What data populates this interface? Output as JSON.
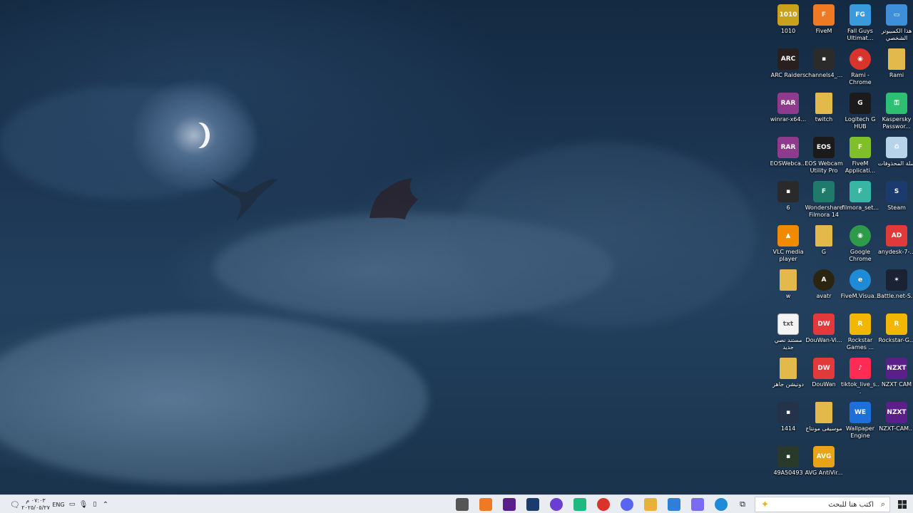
{
  "desktop_icons": [
    {
      "label": "1010",
      "icon": "game-box-icon",
      "color": "#c8a21a"
    },
    {
      "label": "FiveM",
      "icon": "fivem-icon",
      "color": "#f07a24"
    },
    {
      "label": "Fall Guys Ultimat...",
      "icon": "fall-guys-icon",
      "color": "#3a9bdc"
    },
    {
      "label": "هذا الكمبيوتر الشخصي",
      "icon": "computer-icon",
      "color": "#3c8fd8"
    },
    {
      "label": "ARC Raiders",
      "icon": "arc-raiders-icon",
      "color": "#2a1f1f"
    },
    {
      "label": "channels4_...",
      "icon": "image-file-icon",
      "color": "#2b2b2b"
    },
    {
      "label": "Rami - Chrome",
      "icon": "chrome-icon",
      "color": "#d9342b"
    },
    {
      "label": "Rami",
      "icon": "folder-icon",
      "color": "#e2b94a"
    },
    {
      "label": "winrar-x64...",
      "icon": "winrar-icon",
      "color": "#8e3b8e"
    },
    {
      "label": "twitch",
      "icon": "folder-icon",
      "color": "#e2b94a"
    },
    {
      "label": "Logitech G HUB",
      "icon": "logitech-g-icon",
      "color": "#1b1b1b"
    },
    {
      "label": "Kaspersky Passwor...",
      "icon": "kaspersky-key-icon",
      "color": "#2fbf71"
    },
    {
      "label": "EOSWebca...",
      "icon": "winrar-icon",
      "color": "#8e3b8e"
    },
    {
      "label": "EOS Webcam Utility Pro",
      "icon": "eos-webcam-icon",
      "color": "#1a1a1a"
    },
    {
      "label": "FiveM Applicati...",
      "icon": "fivem-app-icon",
      "color": "#7fbf2a"
    },
    {
      "label": "سلة المحذوفات",
      "icon": "recycle-bin-icon",
      "color": "#b8d4ea"
    },
    {
      "label": "6",
      "icon": "image-file-icon",
      "color": "#2a2a2a"
    },
    {
      "label": "Wondershare Filmora 14",
      "icon": "filmora-icon",
      "color": "#1f7a6b"
    },
    {
      "label": "filmora_set...",
      "icon": "filmora-setup-icon",
      "color": "#39b5a3"
    },
    {
      "label": "Steam",
      "icon": "steam-icon",
      "color": "#1b3b6f"
    },
    {
      "label": "VLC media player",
      "icon": "vlc-icon",
      "color": "#f08a00"
    },
    {
      "label": "G",
      "icon": "folder-icon",
      "color": "#e2b94a"
    },
    {
      "label": "Google Chrome",
      "icon": "chrome-icon",
      "color": "#2d9b4a"
    },
    {
      "label": "anydesk-7-...",
      "icon": "anydesk-icon",
      "color": "#e23a3a"
    },
    {
      "label": "w",
      "icon": "folder-icon",
      "color": "#e2b94a"
    },
    {
      "label": "avatr",
      "icon": "avatr-icon",
      "color": "#2a2410"
    },
    {
      "label": "FiveM.Visua...",
      "icon": "edge-icon",
      "color": "#1f8ad6"
    },
    {
      "label": "Battle.net-S...",
      "icon": "battlenet-icon",
      "color": "#1a2233"
    },
    {
      "label": "مستند نصي جديد",
      "icon": "text-document-icon",
      "color": "#f4f4f4"
    },
    {
      "label": "DouWan-Vi...",
      "icon": "douwan-icon",
      "color": "#e2393b"
    },
    {
      "label": "Rockstar Games ...",
      "icon": "rockstar-icon",
      "color": "#f2b705"
    },
    {
      "label": "Rockstar-G...",
      "icon": "rockstar-icon",
      "color": "#f2b705"
    },
    {
      "label": "دونيشن جاهز",
      "icon": "folder-icon",
      "color": "#e2b94a"
    },
    {
      "label": "DouWan",
      "icon": "douwan-icon",
      "color": "#e2393b"
    },
    {
      "label": "tiktok_live_s...",
      "icon": "tiktok-icon",
      "color": "#fe2c55"
    },
    {
      "label": "NZXT CAM",
      "icon": "nzxt-icon",
      "color": "#5b1f8a"
    },
    {
      "label": "1414",
      "icon": "image-file-icon",
      "color": "#24324a"
    },
    {
      "label": "موسيقى مونتاج",
      "icon": "folder-icon",
      "color": "#e2b94a"
    },
    {
      "label": "Wallpaper Engine",
      "icon": "wallpaper-engine-icon",
      "color": "#1e6fd9"
    },
    {
      "label": "NZXT-CAM...",
      "icon": "nzxt-icon",
      "color": "#5b1f8a"
    },
    {
      "label": "49A50493",
      "icon": "image-file-icon",
      "color": "#2a3a2a"
    },
    {
      "label": "AVG AntiVir...",
      "icon": "avg-icon",
      "color": "#e8a317"
    }
  ],
  "icon_texts": {
    "fall_guys": "FG",
    "arc": "ARC",
    "eos": "EOS",
    "nzxt": "NZXT",
    "avatr": "A",
    "g": "G",
    "r": "R",
    "steam": "S",
    "filmora": "F",
    "avg": "AVG",
    "anydesk": "AD",
    "txt": "txt",
    "douwan": "DW",
    "tiktok": "♪",
    "vlc": "▲",
    "fivem": "F",
    "winrar": "RAR",
    "battlenet": "✶",
    "edge": "e",
    "chrome": "◉",
    "logitech": "G",
    "kaspersky": "⚿",
    "recycle": "♻",
    "wallpaper": "WE",
    "computer": "▭",
    "img": "▪",
    "folder": "",
    "game1010": "1010"
  },
  "taskbar": {
    "search_placeholder": "اكتب هنا للبحث",
    "language": "ENG",
    "time": "٠٧:٠٣ م",
    "date": "٢٠٢٥/٠٥/٢٧",
    "pinned_apps": [
      {
        "name": "task-view-icon",
        "color": "#555"
      },
      {
        "name": "fivem-icon",
        "color": "#f07a24"
      },
      {
        "name": "nzxt-cam-icon",
        "color": "#5b1f8a"
      },
      {
        "name": "steam-icon",
        "color": "#1b3b6f"
      },
      {
        "name": "ring-app-icon",
        "color": "#6a3fd0"
      },
      {
        "name": "green-app-icon",
        "color": "#1db980"
      },
      {
        "name": "chrome-profile-icon",
        "color": "#d9342b"
      },
      {
        "name": "discord-icon",
        "color": "#5865f2"
      },
      {
        "name": "file-explorer-icon",
        "color": "#e7b13a"
      },
      {
        "name": "microsoft-store-icon",
        "color": "#2f7fd8"
      },
      {
        "name": "copilot-icon",
        "color": "#7a6cf0"
      },
      {
        "name": "edge-icon",
        "color": "#1f8ad6"
      }
    ]
  },
  "colors": {
    "taskbar_bg": "#e9ecf0",
    "label_text": "#ffffff"
  }
}
